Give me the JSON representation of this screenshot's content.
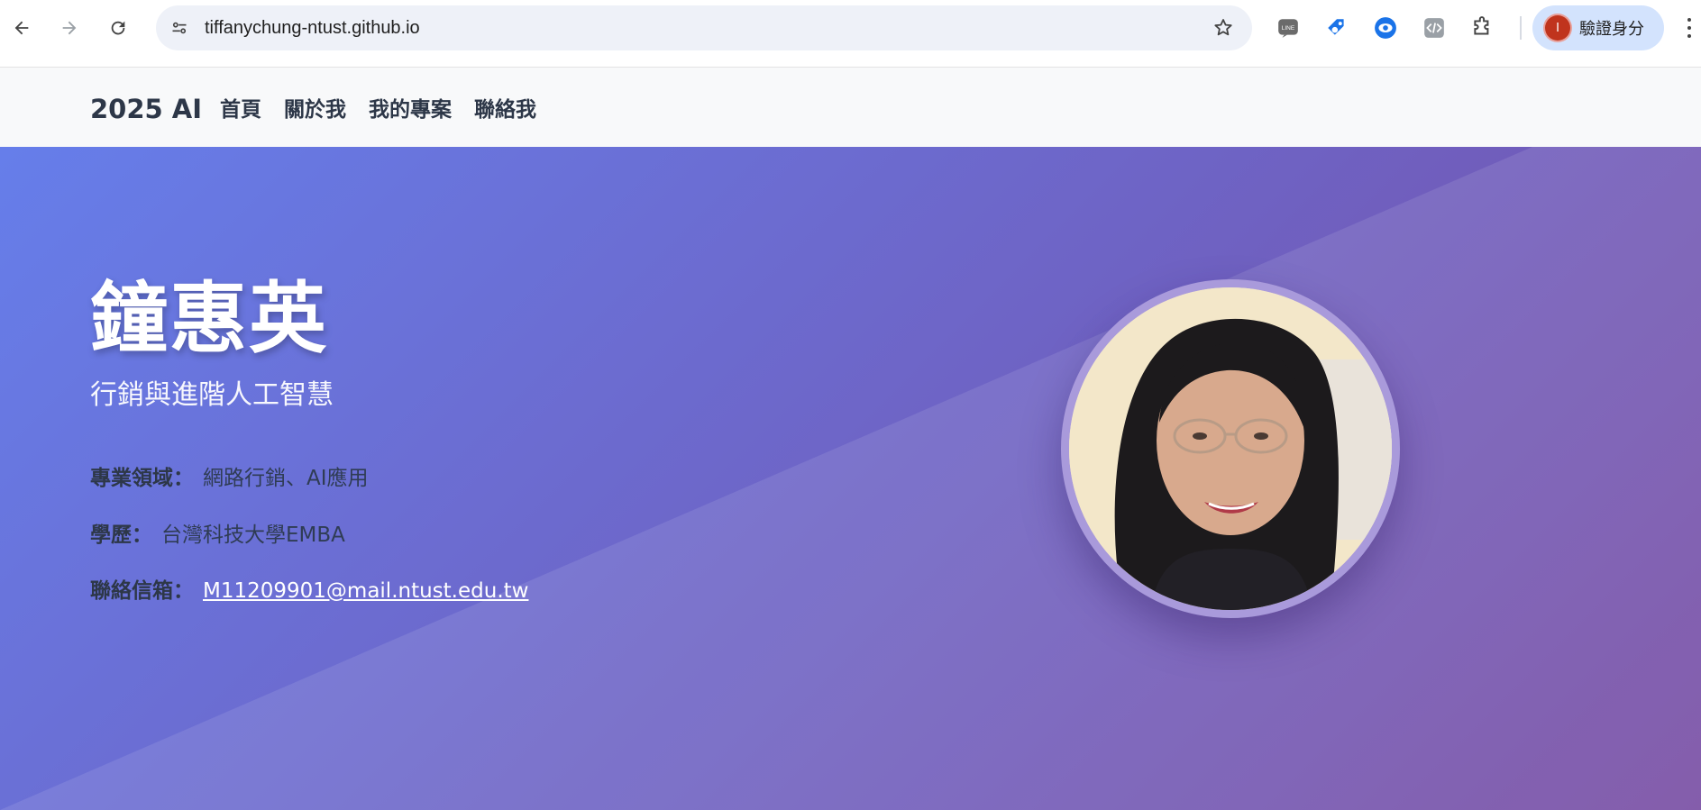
{
  "browser": {
    "url": "tiffanychung-ntust.github.io",
    "profile_label": "驗證身分",
    "profile_initial": "I"
  },
  "site": {
    "brand": "2025 AI",
    "nav": [
      {
        "label": "首頁"
      },
      {
        "label": "關於我"
      },
      {
        "label": "我的專案"
      },
      {
        "label": "聯絡我"
      }
    ]
  },
  "hero": {
    "name": "鐘惠英",
    "subtitle": "行銷與進階人工智慧",
    "expertise_label": "專業領域：",
    "expertise_value": "網路行銷、AI應用",
    "education_label": "學歷：",
    "education_value": "台灣科技大學EMBA",
    "contact_label": "聯絡信箱：",
    "contact_email": "M11209901@mail.ntust.edu.tw"
  },
  "colors": {
    "gradient_start": "#667eea",
    "gradient_end": "#764ba2",
    "photo_border": "#a99adb"
  }
}
